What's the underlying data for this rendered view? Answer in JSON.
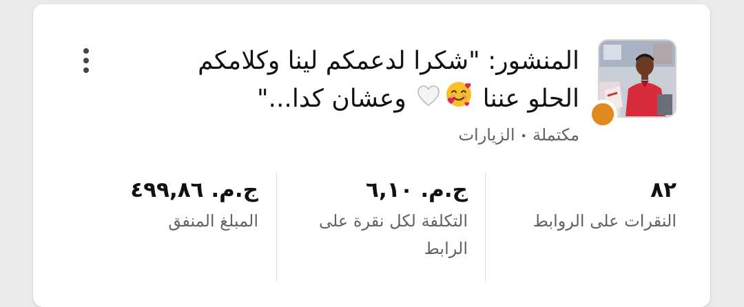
{
  "post": {
    "text_line1": "المنشور: \"شكرا لدعمكم لينا وكلامكم",
    "text_line2_before": "الحلو عننا",
    "text_line2_after": "وعشان كدا...\"",
    "emoji_1": "smiling-face-with-hearts",
    "emoji_2": "white-heart",
    "status": "مكتملة",
    "separator": "•",
    "objective": "الزيارات",
    "status_color": "#e08a1e"
  },
  "stats": [
    {
      "value": "٨٢",
      "label": "النقرات على الروابط"
    },
    {
      "value": "ج.م. ٦,١٠",
      "label": "التكلفة لكل نقرة على الرابط"
    },
    {
      "value": "ج.م. ٤٩٩,٨٦",
      "label": "المبلغ المنفق"
    }
  ],
  "icons": {
    "menu": "more-vertical-icon"
  }
}
